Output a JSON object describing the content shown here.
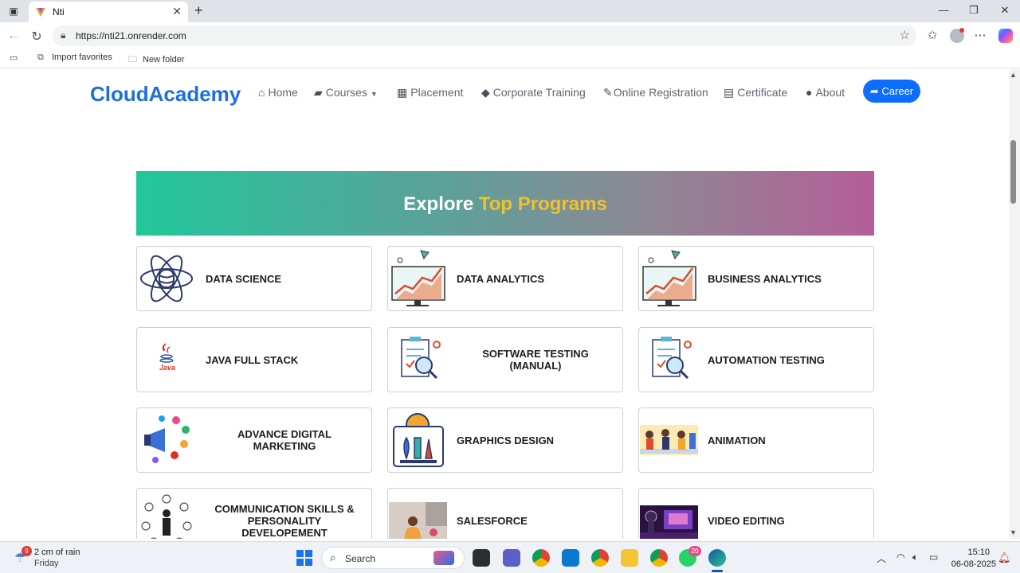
{
  "browser": {
    "tab_title": "Nti",
    "url": "https://nti21.onrender.com",
    "favorites": [
      "Import favorites",
      "New folder"
    ]
  },
  "site": {
    "brand": "CloudAcademy",
    "nav": [
      {
        "label": "Home",
        "icon": "home-icon"
      },
      {
        "label": "Courses",
        "icon": "briefcase-icon"
      },
      {
        "label": "Placement",
        "icon": "building-icon"
      },
      {
        "label": "Corporate Training",
        "icon": "graduation-cap-icon"
      },
      {
        "label": "Online Registration",
        "icon": "edit-icon"
      },
      {
        "label": "Certificate",
        "icon": "id-card-icon"
      },
      {
        "label": "About",
        "icon": "chevron-circle-icon"
      }
    ],
    "career_label": "Career",
    "banner_title_main": "Explore ",
    "banner_title_accent": "Top Programs",
    "programs": [
      "DATA SCIENCE",
      "DATA ANALYTICS",
      "BUSINESS ANALYTICS",
      "JAVA FULL STACK",
      "SOFTWARE TESTING (MANUAL)",
      "AUTOMATION TESTING",
      "ADVANCE DIGITAL MARKETING",
      "GRAPHICS DESIGN",
      "ANIMATION",
      "COMMUNICATION SKILLS & PERSONALITY DEVELOPEMENT",
      "SALESFORCE",
      "VIDEO EDITING"
    ],
    "java_logo_text": "Java"
  },
  "taskbar": {
    "weather_badge": "9",
    "weather_line1": "2 cm of rain",
    "weather_line2": "Friday",
    "search_label": "Search",
    "whatsapp_badge": "20",
    "time": "15:10",
    "date": "06-08-2025"
  },
  "colors": {
    "brand": "#1d6fe0",
    "career_button": "#0d6efd",
    "banner_accent": "#f3c028"
  }
}
